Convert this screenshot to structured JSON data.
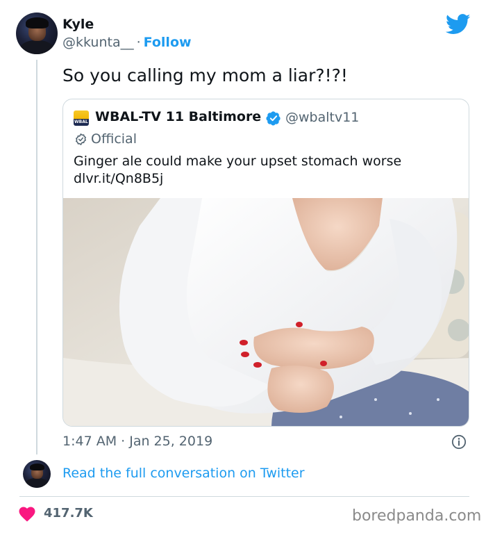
{
  "user": {
    "name": "Kyle",
    "handle": "@kkunta__",
    "separator": "·",
    "follow_label": "Follow"
  },
  "tweet": {
    "text": "So you calling my mom a liar?!?!",
    "timestamp": "1:47 AM · Jan 25, 2019"
  },
  "quoted": {
    "name": "WBAL-TV 11 Baltimore",
    "handle": "@wbaltv11",
    "label": "Official",
    "text": "Ginger ale could make your upset stomach worse",
    "link": "dlvr.it/Qn8B5j",
    "logo_text": "WBAL"
  },
  "conversation_link": "Read the full conversation on Twitter",
  "likes": "417.7K",
  "watermark": "boredpanda.com",
  "colors": {
    "accent": "#1d9bf0",
    "heart": "#f91880",
    "text_secondary": "#536471",
    "border": "#cfd9de"
  },
  "icons": {
    "brand": "twitter-bird-icon",
    "verified": "verified-badge-icon",
    "official": "official-check-icon",
    "info": "info-icon",
    "likes": "heart-icon"
  }
}
